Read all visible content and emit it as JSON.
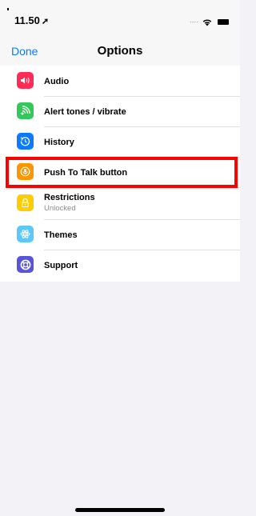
{
  "status": {
    "time": "11.50",
    "location_glyph": "➚",
    "cell_dots": "....",
    "wifi_icon": "wifi-icon",
    "battery_icon": "battery-icon"
  },
  "nav": {
    "done_label": "Done",
    "title": "Options"
  },
  "items": [
    {
      "label": "Audio",
      "icon": "speaker-icon",
      "color": "#ff2d55"
    },
    {
      "label": "Alert tones / vibrate",
      "icon": "vibrate-icon",
      "color": "#34c759"
    },
    {
      "label": "History",
      "icon": "history-icon",
      "color": "#0a7aff"
    },
    {
      "label": "Push To Talk button",
      "icon": "microphone-icon",
      "color": "#ff9500"
    },
    {
      "label": "Restrictions",
      "sublabel": "Unlocked",
      "icon": "lock-icon",
      "color": "#ffcc00"
    },
    {
      "label": "Themes",
      "icon": "atom-icon",
      "color": "#5ac8fa"
    },
    {
      "label": "Support",
      "icon": "lifebuoy-icon",
      "color": "#5856d6"
    }
  ],
  "highlight_color": "#ff0000"
}
